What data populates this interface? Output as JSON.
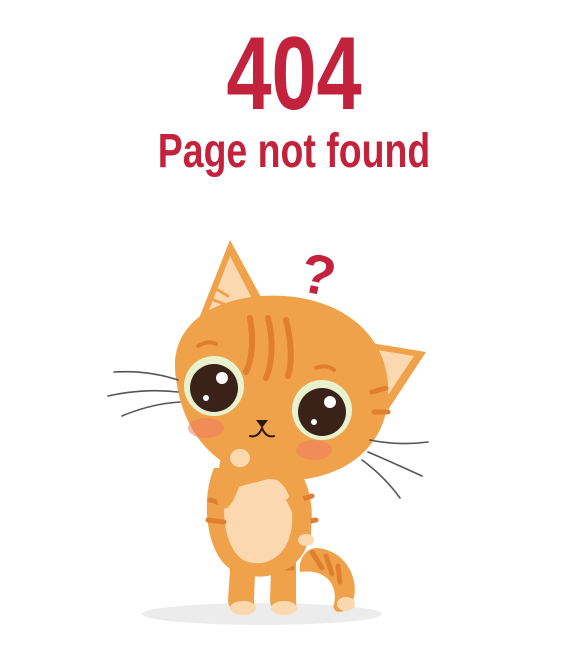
{
  "error": {
    "code": "404",
    "message": "Page not found"
  },
  "question_mark": "?",
  "illustration": {
    "subject": "confused-orange-cat"
  },
  "colors": {
    "accent": "#c3223c",
    "cat_orange": "#f0a24a",
    "cat_dark": "#e07f2e",
    "cat_light": "#fbd8b0",
    "eye": "#3a2218",
    "cheek": "#f07a62",
    "shadow": "#e6e6e6"
  }
}
